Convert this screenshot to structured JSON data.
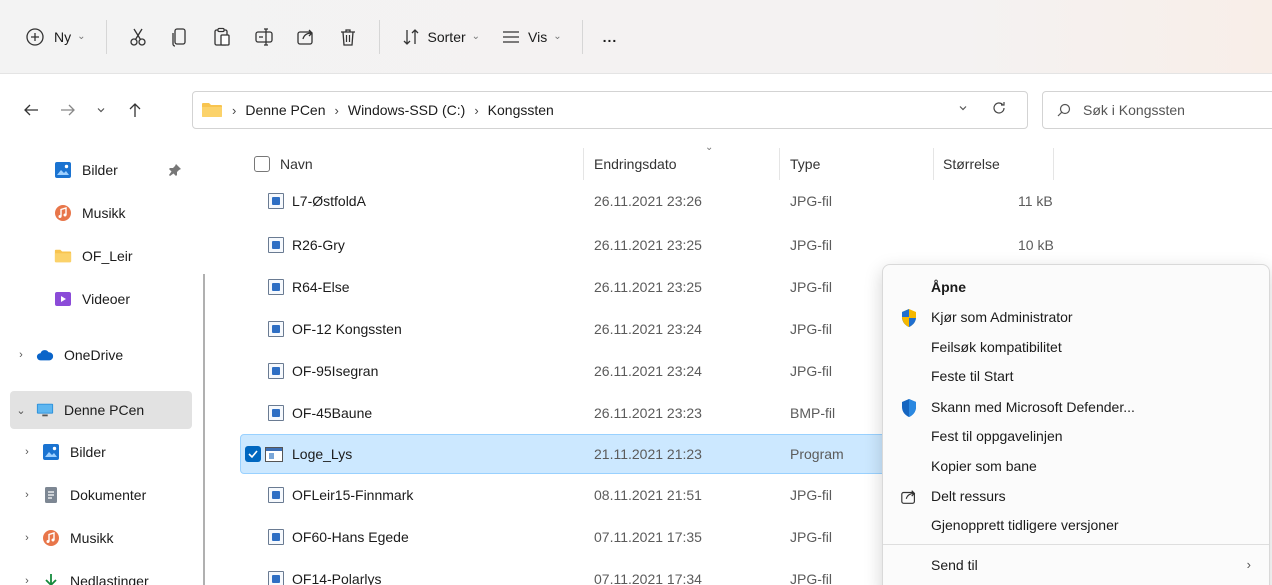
{
  "toolbar": {
    "new_label": "Ny",
    "sort_label": "Sorter",
    "view_label": "Vis",
    "more_label": "..."
  },
  "breadcrumb": [
    "Denne PCen",
    "Windows-SSD (C:)",
    "Kongssten"
  ],
  "search": {
    "placeholder": "Søk i Kongssten"
  },
  "sidebar": {
    "items": [
      {
        "label": "Bilder",
        "icon": "pictures-icon",
        "pinned": true
      },
      {
        "label": "Musikk",
        "icon": "music-icon"
      },
      {
        "label": "OF_Leir",
        "icon": "folder-icon"
      },
      {
        "label": "Videoer",
        "icon": "videos-icon"
      },
      {
        "label": "OneDrive",
        "icon": "onedrive-icon",
        "expandable": true
      },
      {
        "label": "Denne PCen",
        "icon": "this-pc-icon",
        "expanded": true,
        "selected": true
      },
      {
        "label": "Bilder",
        "icon": "pictures-icon",
        "expandable": true
      },
      {
        "label": "Dokumenter",
        "icon": "documents-icon",
        "expandable": true
      },
      {
        "label": "Musikk",
        "icon": "music-icon",
        "expandable": true
      },
      {
        "label": "Nedlastinger",
        "icon": "downloads-icon",
        "expandable": true
      }
    ]
  },
  "columns": {
    "name": "Navn",
    "date": "Endringsdato",
    "type": "Type",
    "size": "Størrelse"
  },
  "files": [
    {
      "name": "L7-ØstfoldA",
      "date": "26.11.2021 23:26",
      "type": "JPG-fil",
      "size": "11 kB",
      "icon": "image-file-icon"
    },
    {
      "name": "R26-Gry",
      "date": "26.11.2021 23:25",
      "type": "JPG-fil",
      "size": "10 kB",
      "icon": "image-file-icon"
    },
    {
      "name": "R64-Else",
      "date": "26.11.2021 23:25",
      "type": "JPG-fil",
      "size": "",
      "icon": "image-file-icon"
    },
    {
      "name": "OF-12 Kongssten",
      "date": "26.11.2021 23:24",
      "type": "JPG-fil",
      "size": "",
      "icon": "image-file-icon"
    },
    {
      "name": "OF-95Isegran",
      "date": "26.11.2021 23:24",
      "type": "JPG-fil",
      "size": "",
      "icon": "image-file-icon"
    },
    {
      "name": "OF-45Baune",
      "date": "26.11.2021 23:23",
      "type": "BMP-fil",
      "size": "",
      "icon": "image-file-icon"
    },
    {
      "name": "Loge_Lys",
      "date": "21.11.2021 21:23",
      "type": "Program",
      "size": "",
      "icon": "program-icon",
      "selected": true
    },
    {
      "name": "OFLeir15-Finnmark",
      "date": "08.11.2021 21:51",
      "type": "JPG-fil",
      "size": "",
      "icon": "image-file-icon"
    },
    {
      "name": "OF60-Hans Egede",
      "date": "07.11.2021 17:35",
      "type": "JPG-fil",
      "size": "",
      "icon": "image-file-icon"
    },
    {
      "name": "OF14-Polarlys",
      "date": "07.11.2021 17:34",
      "type": "JPG-fil",
      "size": "",
      "icon": "image-file-icon"
    }
  ],
  "context_menu": {
    "items": [
      {
        "label": "Åpne",
        "bold": true,
        "icon": ""
      },
      {
        "label": "Kjør som Administrator",
        "icon": "uac-shield-icon"
      },
      {
        "label": "Feilsøk kompatibilitet",
        "icon": ""
      },
      {
        "label": "Feste til Start",
        "icon": ""
      },
      {
        "label": "Skann med Microsoft Defender...",
        "icon": "defender-shield-icon"
      },
      {
        "label": "Fest til oppgavelinjen",
        "icon": ""
      },
      {
        "label": "Kopier som bane",
        "icon": ""
      },
      {
        "label": "Delt ressurs",
        "icon": "share-icon"
      },
      {
        "label": "Gjenopprett tidligere versjoner",
        "icon": ""
      },
      {
        "label": "Send til",
        "icon": "",
        "submenu": true
      }
    ]
  },
  "colors": {
    "accent": "#0067c0",
    "selection": "#cce8ff",
    "folder": "#f8c44f"
  }
}
